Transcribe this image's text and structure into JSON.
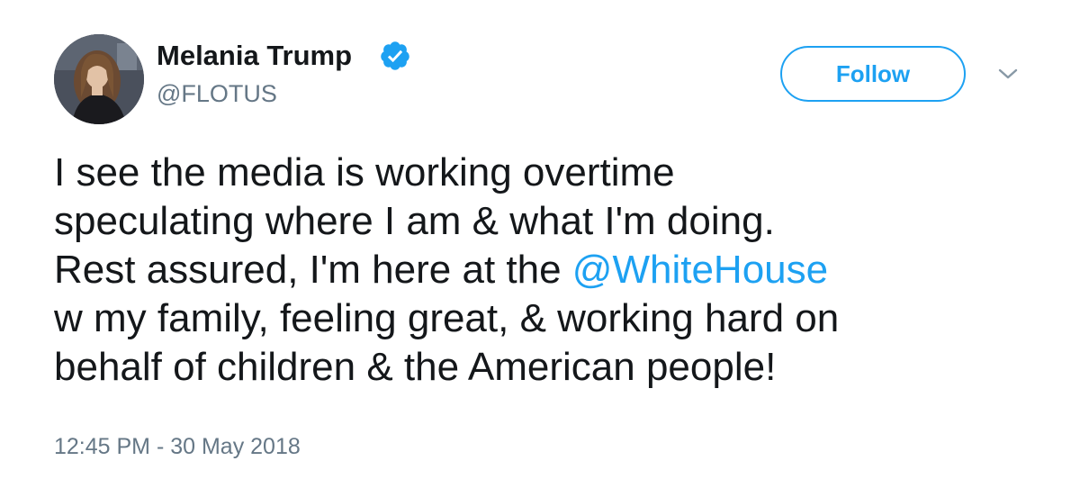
{
  "user": {
    "display_name": "Melania Trump",
    "handle": "@FLOTUS",
    "verified": true,
    "avatar_icon": "profile-photo"
  },
  "actions": {
    "follow_label": "Follow",
    "more_icon": "chevron-down-icon"
  },
  "tweet": {
    "lines": [
      {
        "text": "I see the media is working overtime"
      },
      {
        "text": "speculating where I am & what I'm doing."
      },
      {
        "before": "Rest assured, I'm here at the ",
        "mention": "@WhiteHouse"
      },
      {
        "text": "w my family, feeling great, & working hard on"
      },
      {
        "text": "behalf of children & the American people!"
      }
    ],
    "timestamp": "12:45 PM - 30 May 2018"
  },
  "colors": {
    "accent": "#1da1f2",
    "text": "#14171a",
    "muted": "#657786"
  }
}
